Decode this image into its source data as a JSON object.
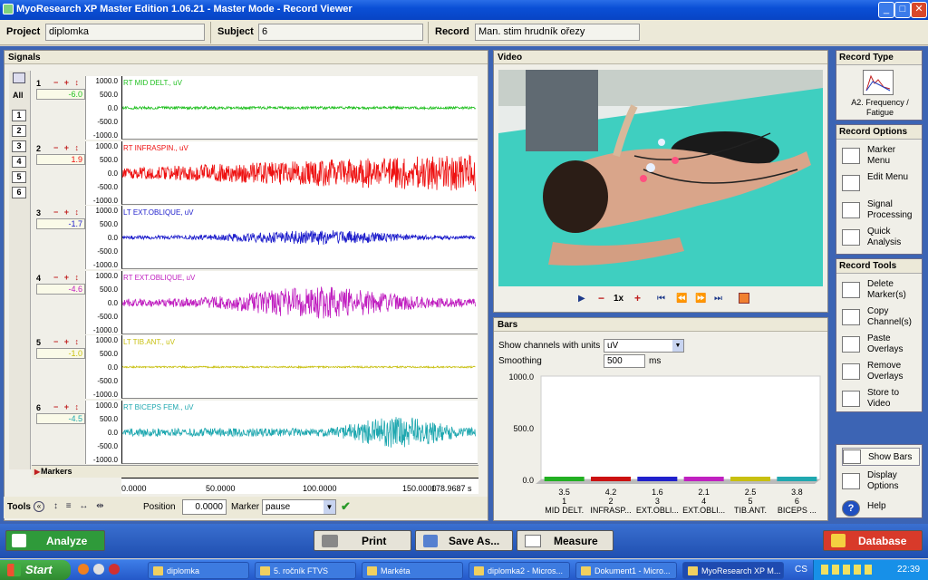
{
  "window": {
    "title": "MyoResearch XP Master Edition 1.06.21 - Master Mode - Record Viewer",
    "min": "_",
    "max": "□",
    "close": "✕"
  },
  "top": {
    "project_label": "Project",
    "project_value": "diplomka",
    "subject_label": "Subject",
    "subject_value": "6",
    "record_label": "Record",
    "record_value": "Man. stim hrudník ořezy"
  },
  "signals": {
    "title": "Signals",
    "all_label": "All",
    "channel_buttons": [
      "1",
      "2",
      "3",
      "4",
      "5",
      "6"
    ],
    "ctrl": "− + ↕",
    "yticks": [
      "1000.0",
      "500.0",
      "0.0",
      "-500.0",
      "-1000.0"
    ],
    "channels": [
      {
        "num": "1",
        "value": "-6.0",
        "label": "RT MID DELT., uV",
        "color": "#22c022",
        "amp": 0.08,
        "profile": "flat"
      },
      {
        "num": "2",
        "value": "1.9",
        "label": "RT INFRASPIN., uV",
        "color": "#ee1111",
        "amp": 0.55,
        "profile": "rise"
      },
      {
        "num": "3",
        "value": "-1.7",
        "label": "LT EXT.OBLIQUE, uV",
        "color": "#2020cc",
        "amp": 0.22,
        "profile": "mid"
      },
      {
        "num": "4",
        "value": "-4.6",
        "label": "RT EXT.OBLIQUE, uV",
        "color": "#c020c0",
        "amp": 0.48,
        "profile": "mid"
      },
      {
        "num": "5",
        "value": "-1.0",
        "label": "LT TIB.ANT., uV",
        "color": "#c8c010",
        "amp": 0.05,
        "profile": "flat"
      },
      {
        "num": "6",
        "value": "-4.5",
        "label": "RT BICEPS FEM., uV",
        "color": "#20a8b0",
        "amp": 0.5,
        "profile": "late"
      }
    ],
    "markers_label": "Markers",
    "xticks": [
      "0.0000",
      "50.0000",
      "100.0000",
      "150.0000",
      "178.9687 s"
    ]
  },
  "tools": {
    "label": "Tools",
    "position_label": "Position",
    "position_value": "0.0000",
    "marker_label": "Marker",
    "marker_value": "pause"
  },
  "video": {
    "title": "Video",
    "speed": "1x",
    "minus": "−",
    "plus": "+"
  },
  "bars": {
    "title": "Bars",
    "units_label": "Show channels with units",
    "units_value": "uV",
    "smoothing_label": "Smoothing",
    "smoothing_value": "500",
    "smoothing_unit": "ms"
  },
  "chart_data": {
    "type": "bar",
    "categories": [
      "MID DELT.",
      "INFRASP...",
      "EXT.OBLI...",
      "EXT.OBLI...",
      "TIB.ANT.",
      "BICEPS ..."
    ],
    "channel_numbers": [
      "1",
      "2",
      "3",
      "4",
      "5",
      "6"
    ],
    "values": [
      3.5,
      4.2,
      1.6,
      2.1,
      2.5,
      3.8
    ],
    "value_labels": [
      "3.5",
      "4.2",
      "1.6",
      "2.1",
      "2.5",
      "3.8"
    ],
    "colors": [
      "#22b022",
      "#cc1111",
      "#2020cc",
      "#c020c0",
      "#c8c010",
      "#20a8b0"
    ],
    "ylim": [
      0,
      1000
    ],
    "yticks": [
      "1000.0",
      "500.0",
      "0.0"
    ],
    "title": "",
    "xlabel": "",
    "ylabel": ""
  },
  "side": {
    "record_type": {
      "title": "Record Type",
      "label": "A2. Frequency / Fatigue"
    },
    "record_options": {
      "title": "Record Options",
      "items": [
        "Marker Menu",
        "Edit Menu",
        "Signal Processing",
        "Quick Analysis"
      ]
    },
    "record_tools": {
      "title": "Record Tools",
      "items": [
        "Delete Marker(s)",
        "Copy Channel(s)",
        "Paste Overlays",
        "Remove Overlays",
        "Store to Video"
      ]
    },
    "bottom": {
      "items": [
        "Show Bars",
        "Display Options",
        "Help"
      ]
    }
  },
  "bottom": {
    "analyze": "Analyze",
    "print": "Print",
    "save_as": "Save As...",
    "measure": "Measure",
    "database": "Database"
  },
  "taskbar": {
    "start": "Start",
    "tasks": [
      "diplomka",
      "5. ročník FTVS",
      "Markéta",
      "diplomka2 - Micros...",
      "Dokument1 - Micro...",
      "MyoResearch XP M..."
    ],
    "lang": "CS",
    "clock": "22:39"
  }
}
